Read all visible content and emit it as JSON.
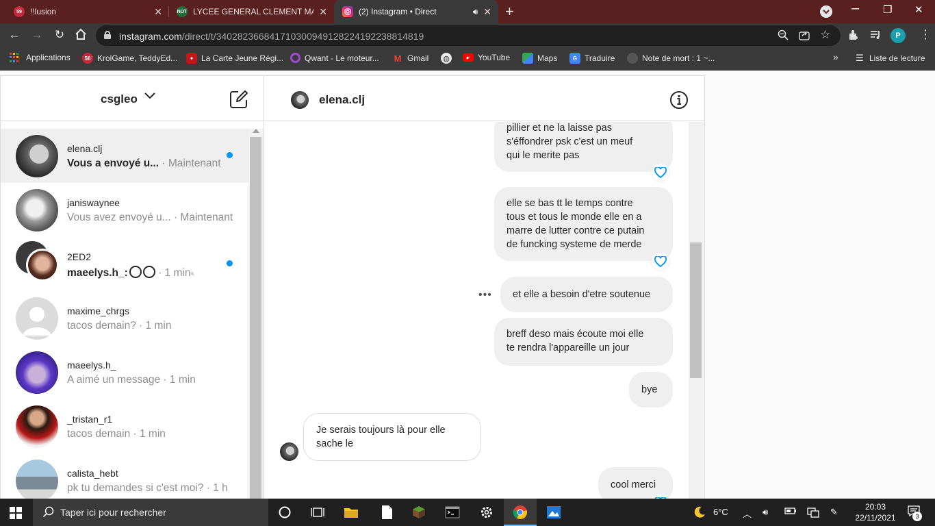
{
  "browser": {
    "tabs": [
      {
        "title": "!!lusion",
        "favicon_text": "59"
      },
      {
        "title": "LYCEE GENERAL CLEMENT MARO",
        "favicon_text": "NOT"
      },
      {
        "title": "(2) Instagram • Direct",
        "active": true
      }
    ],
    "url_host": "instagram.com",
    "url_path": "/direct/t/340282366841710300949128224192238814819",
    "profile_initial": "P",
    "bookmarks": [
      {
        "label": "Applications"
      },
      {
        "label": "KrolGame, TeddyEd..."
      },
      {
        "label": "La Carte Jeune Régi..."
      },
      {
        "label": "Qwant - Le moteur..."
      },
      {
        "label": "Gmail"
      },
      {
        "label": ""
      },
      {
        "label": "YouTube"
      },
      {
        "label": "Maps"
      },
      {
        "label": "Traduire"
      },
      {
        "label": "Note de mort : 1 ~..."
      }
    ],
    "reading_list": "Liste de lecture",
    "more_bookmarks": "»"
  },
  "inbox": {
    "username": "csgleo",
    "threads": [
      {
        "name": "elena.clj",
        "preview": "Vous a envoyé u...",
        "time": "· Maintenant",
        "unread": true,
        "selected": true
      },
      {
        "name": "janiswaynee",
        "preview": "Vous avez envoyé u...",
        "time": "· Maintenant",
        "unread": false
      },
      {
        "name": "2ED2",
        "preview": "maeelys.h_:",
        "time": "· 1 min",
        "unread": true,
        "muted": true
      },
      {
        "name": "maxime_chrgs",
        "preview": "tacos demain?",
        "time": "· 1 min",
        "unread": false
      },
      {
        "name": "maeelys.h_",
        "preview": "A aimé un message",
        "time": "· 1 min",
        "unread": false
      },
      {
        "name": "_tristan_r1",
        "preview": "tacos demain",
        "time": "· 1 min",
        "unread": false
      },
      {
        "name": "calista_hebt",
        "preview": "pk tu demandes si c'est moi?",
        "time": "· 1 h",
        "unread": false
      }
    ]
  },
  "conversation": {
    "title": "elena.clj",
    "messages": [
      {
        "dir": "out",
        "lines": [
          "pillier et ne la laisse pas",
          "s'éffondrer psk c'est un meuf",
          "qui le merite pas"
        ],
        "liked": true
      },
      {
        "dir": "out",
        "lines": [
          "elle se bas tt le temps contre",
          "tous et tous le monde elle en a",
          "marre de lutter contre ce putain",
          "de funcking systeme de merde"
        ],
        "liked": true
      },
      {
        "dir": "out",
        "lines": [
          "et elle a besoin d'etre soutenue"
        ],
        "liked": false
      },
      {
        "dir": "out",
        "lines": [
          "breff deso mais écoute moi elle",
          "te rendra l'appareille un jour"
        ],
        "liked": false
      },
      {
        "dir": "out",
        "lines": [
          "bye"
        ],
        "liked": false
      },
      {
        "dir": "in",
        "lines": [
          "Je serais toujours là pour elle",
          "sache le"
        ],
        "liked": false
      },
      {
        "dir": "out",
        "lines": [
          "cool merci"
        ],
        "liked": true
      }
    ],
    "more_label": "•••"
  },
  "taskbar": {
    "search_placeholder": "Taper ici pour rechercher",
    "temperature": "6°C",
    "time": "20:03",
    "date": "22/11/2021",
    "notifications": "3"
  },
  "colors": {
    "tabstrip": "#5a2020",
    "chrome_toolbar": "#3a3a3a",
    "unread_dot": "#0095f6",
    "heart": "#0095f6",
    "bubble_out": "#efefef"
  }
}
